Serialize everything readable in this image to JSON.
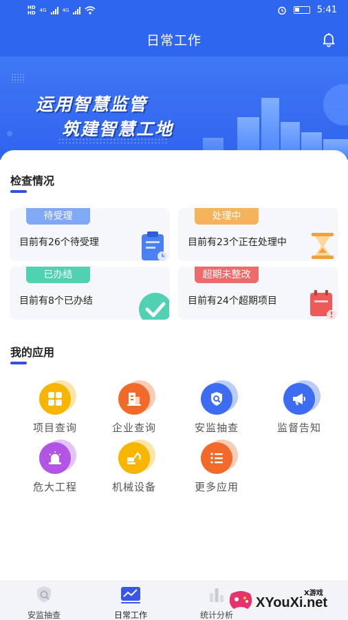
{
  "status_bar": {
    "time": "5:41",
    "hd1": "HD",
    "hd2": "HD",
    "net1": "4G",
    "net2": "4G"
  },
  "header": {
    "title": "日常工作",
    "bell_icon": "bell-icon"
  },
  "banner": {
    "line1": "运用智慧监管",
    "line2": "筑建智慧工地"
  },
  "inspection": {
    "title": "检查情况",
    "tiles": [
      {
        "tag": "待受理",
        "text": "目前有26个待受理",
        "count": 26,
        "color": "#7fa9f5",
        "icon": "clipboard-icon"
      },
      {
        "tag": "处理中",
        "text": "目前有23个正在处理中",
        "count": 23,
        "color": "#f5b35c",
        "icon": "hourglass-icon"
      },
      {
        "tag": "已办结",
        "text": "目前有8个已办结",
        "count": 8,
        "color": "#4fd1b2",
        "icon": "check-icon"
      },
      {
        "tag": "超期未整改",
        "text": "目前有24个超期项目",
        "count": 24,
        "color": "#ef6a6a",
        "icon": "overdue-calendar-icon"
      }
    ]
  },
  "apps": {
    "title": "我的应用",
    "items": [
      {
        "label": "项目查询",
        "icon": "grid-icon",
        "color": "#f7b500"
      },
      {
        "label": "企业查询",
        "icon": "building-icon",
        "color": "#f26a2a"
      },
      {
        "label": "安监抽查",
        "icon": "search-shield-icon",
        "color": "#3d6cf2"
      },
      {
        "label": "监督告知",
        "icon": "megaphone-icon",
        "color": "#3d6cf2"
      },
      {
        "label": "危大工程",
        "icon": "alarm-light-icon",
        "color": "#b255e6"
      },
      {
        "label": "机械设备",
        "icon": "excavator-icon",
        "color": "#f7b500"
      },
      {
        "label": "更多应用",
        "icon": "list-icon",
        "color": "#f26a2a"
      }
    ]
  },
  "tabbar": {
    "tabs": [
      {
        "label": "安监抽查",
        "icon": "shield-search-icon",
        "active": false
      },
      {
        "label": "日常工作",
        "icon": "chart-line-icon",
        "active": true
      },
      {
        "label": "统计分析",
        "icon": "bar-chart-icon",
        "active": false
      }
    ]
  },
  "watermark": {
    "site": "XYouXi.net",
    "tag": "X游戏"
  }
}
